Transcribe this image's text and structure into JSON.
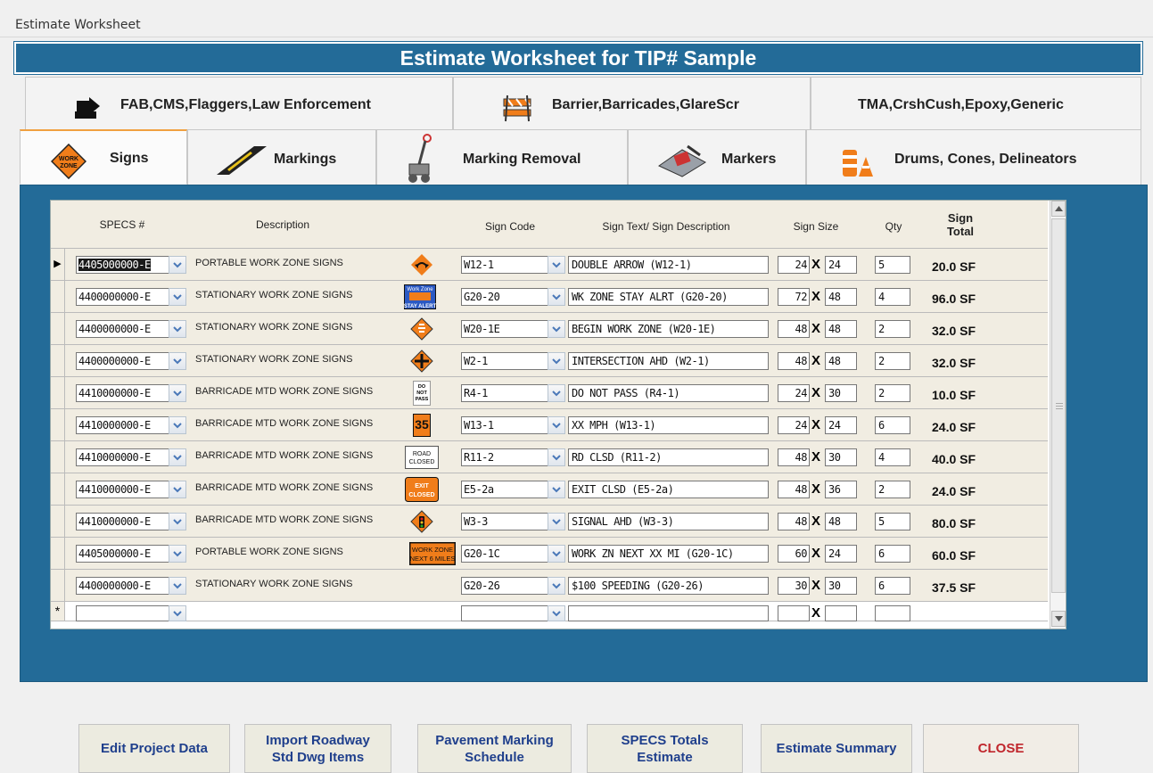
{
  "window_title": "Estimate Worksheet",
  "header": "Estimate Worksheet for TIP# Sample",
  "tabs_row1": [
    {
      "label": "FAB,CMS,Flaggers,Law Enforcement",
      "icon": "arrow-board-icon"
    },
    {
      "label": "Barrier,Barricades,GlareScr",
      "icon": "barricade-icon"
    },
    {
      "label": "TMA,CrshCush,Epoxy,Generic",
      "icon": ""
    }
  ],
  "tabs_row2": [
    {
      "label": "Signs",
      "icon": "work-zone-sign-icon",
      "active": true
    },
    {
      "label": "Markings",
      "icon": "pavement-marking-icon"
    },
    {
      "label": "Marking Removal",
      "icon": "marking-removal-machine-icon"
    },
    {
      "label": "Markers",
      "icon": "marker-machine-icon"
    },
    {
      "label": "Drums, Cones, Delineators",
      "icon": "drums-cones-icon"
    }
  ],
  "columns": {
    "specs": "SPECS #",
    "description": "Description",
    "sign_code": "Sign Code",
    "sign_text": "Sign Text/ Sign Description",
    "sign_size": "Sign Size",
    "qty": "Qty",
    "sign_total_1": "Sign",
    "sign_total_2": "Total"
  },
  "rows": [
    {
      "specs": "4405000000-E",
      "desc": "PORTABLE WORK ZONE SIGNS",
      "code": "W12-1",
      "text": "DOUBLE ARROW (W12-1)",
      "w": "24",
      "h": "24",
      "qty": "5",
      "total": "20.0 SF",
      "icon": "double-arrow-sign-icon",
      "current": true
    },
    {
      "specs": "4400000000-E",
      "desc": "STATIONARY WORK ZONE SIGNS",
      "code": "G20-20",
      "text": "WK ZONE STAY ALRT (G20-20)",
      "w": "72",
      "h": "48",
      "qty": "4",
      "total": "96.0 SF",
      "icon": "work-zone-stay-alert-sign-icon",
      "sign_lines": [
        "Work Zone",
        "STAY ALERT"
      ]
    },
    {
      "specs": "4400000000-E",
      "desc": "STATIONARY WORK ZONE SIGNS",
      "code": "W20-1E",
      "text": "BEGIN WORK ZONE (W20-1E)",
      "w": "48",
      "h": "48",
      "qty": "2",
      "total": "32.0 SF",
      "icon": "begin-work-zone-sign-icon"
    },
    {
      "specs": "4400000000-E",
      "desc": "STATIONARY WORK ZONE SIGNS",
      "code": "W2-1",
      "text": "INTERSECTION AHD (W2-1)",
      "w": "48",
      "h": "48",
      "qty": "2",
      "total": "32.0 SF",
      "icon": "intersection-ahead-sign-icon"
    },
    {
      "specs": "4410000000-E",
      "desc": "BARRICADE MTD WORK ZONE SIGNS",
      "code": "R4-1",
      "text": "DO NOT PASS (R4-1)",
      "w": "24",
      "h": "30",
      "qty": "2",
      "total": "10.0 SF",
      "icon": "do-not-pass-sign-icon",
      "sign_lines": [
        "DO",
        "NOT",
        "PASS"
      ]
    },
    {
      "specs": "4410000000-E",
      "desc": "BARRICADE MTD WORK ZONE SIGNS",
      "code": "W13-1",
      "text": "XX MPH (W13-1)",
      "w": "24",
      "h": "24",
      "qty": "6",
      "total": "24.0 SF",
      "icon": "speed-35-sign-icon",
      "sign_lines": [
        "35"
      ]
    },
    {
      "specs": "4410000000-E",
      "desc": "BARRICADE MTD WORK ZONE SIGNS",
      "code": "R11-2",
      "text": "RD CLSD (R11-2)",
      "w": "48",
      "h": "30",
      "qty": "4",
      "total": "40.0 SF",
      "icon": "road-closed-sign-icon",
      "sign_lines": [
        "ROAD",
        "CLOSED"
      ]
    },
    {
      "specs": "4410000000-E",
      "desc": "BARRICADE MTD WORK ZONE SIGNS",
      "code": "E5-2a",
      "text": "EXIT CLSD (E5-2a)",
      "w": "48",
      "h": "36",
      "qty": "2",
      "total": "24.0 SF",
      "icon": "exit-closed-sign-icon",
      "sign_lines": [
        "EXIT",
        "CLOSED"
      ]
    },
    {
      "specs": "4410000000-E",
      "desc": "BARRICADE MTD WORK ZONE SIGNS",
      "code": "W3-3",
      "text": "SIGNAL AHD (W3-3)",
      "w": "48",
      "h": "48",
      "qty": "5",
      "total": "80.0 SF",
      "icon": "signal-ahead-sign-icon"
    },
    {
      "specs": "4405000000-E",
      "desc": "PORTABLE WORK ZONE SIGNS",
      "code": "G20-1C",
      "text": "WORK ZN NEXT XX MI (G20-1C)",
      "w": "60",
      "h": "24",
      "qty": "6",
      "total": "60.0 SF",
      "icon": "work-zone-next-miles-sign-icon",
      "sign_lines": [
        "WORK ZONE",
        "NEXT 6 MILES"
      ]
    },
    {
      "specs": "4400000000-E",
      "desc": "STATIONARY WORK ZONE SIGNS",
      "code": "G20-26",
      "text": "$100 SPEEDING (G20-26)",
      "w": "30",
      "h": "30",
      "qty": "6",
      "total": "37.5 SF",
      "icon": ""
    }
  ],
  "new_row_marker": "*",
  "current_row_marker": "▶",
  "size_separator": "X",
  "buttons": [
    {
      "label": "Edit Project Data"
    },
    {
      "label": "Import Roadway Std Dwg Items"
    },
    {
      "label": "Pavement Marking Schedule"
    },
    {
      "label": "SPECS Totals Estimate"
    },
    {
      "label": "Estimate Summary"
    },
    {
      "label": "CLOSE"
    }
  ],
  "colors": {
    "header_bg": "#236b98",
    "button_text": "#1f3f8c",
    "close_text": "#c0262c",
    "sign_orange": "#f07d1a"
  }
}
